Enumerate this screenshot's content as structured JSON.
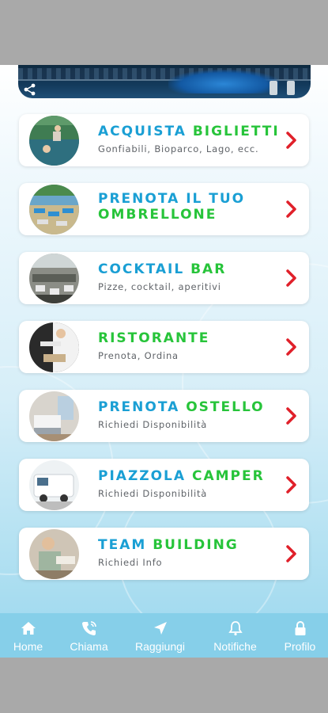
{
  "menu": {
    "items": [
      {
        "title": [
          "ACQUISTA",
          "BIGLIETTI"
        ],
        "subtitle": "Gonfiabili, Bioparco, Lago, ecc."
      },
      {
        "title": [
          "PRENOTA IL TUO",
          "OMBRELLONE"
        ],
        "subtitle": ""
      },
      {
        "title": [
          "COCKTAIL",
          "BAR"
        ],
        "subtitle": "Pizze, cocktail, aperitivi"
      },
      {
        "title": [
          "",
          "RISTORANTE"
        ],
        "subtitle": "Prenota, Ordina"
      },
      {
        "title": [
          "PRENOTA",
          "OSTELLO"
        ],
        "subtitle": "Richiedi Disponibilità"
      },
      {
        "title": [
          "PIAZZOLA",
          "CAMPER"
        ],
        "subtitle": "Richiedi Disponibilità"
      },
      {
        "title": [
          "TEAM",
          "BUILDING"
        ],
        "subtitle": "Richiedi Info"
      }
    ]
  },
  "tabbar": {
    "tabs": [
      {
        "label": "Home",
        "icon": "home-icon"
      },
      {
        "label": "Chiama",
        "icon": "phone-icon"
      },
      {
        "label": "Raggiungi",
        "icon": "navigation-arrow-icon"
      },
      {
        "label": "Notifiche",
        "icon": "bell-icon"
      },
      {
        "label": "Profilo",
        "icon": "lock-icon"
      }
    ]
  },
  "colors": {
    "title_blue": "#1a9fd4",
    "title_green": "#27c43a",
    "chevron_red": "#e0202a",
    "tabbar_bg": "#86cfe9"
  }
}
